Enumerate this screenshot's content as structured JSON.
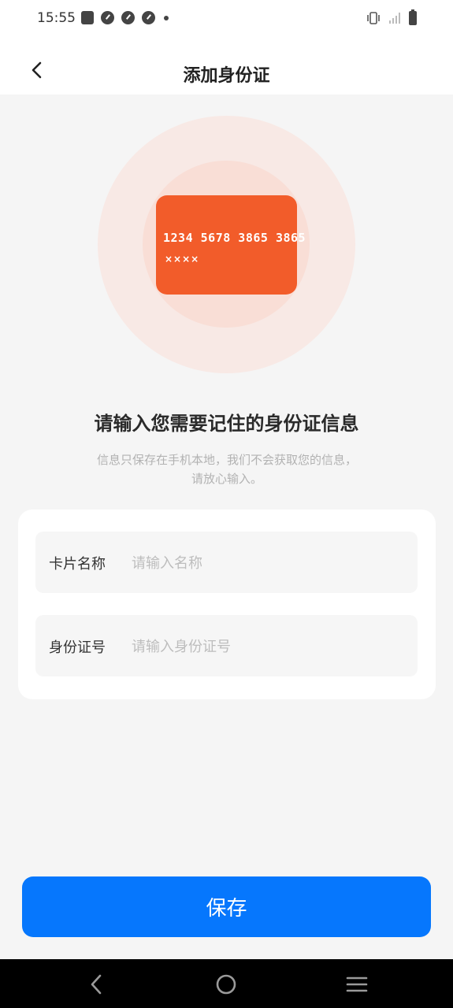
{
  "status_bar": {
    "time": "15:55",
    "icons": [
      "shopping-bag-icon",
      "gauge-icon",
      "gauge-icon",
      "gauge-icon",
      "dot-icon",
      "vibrate-icon",
      "signal-icon",
      "battery-icon"
    ]
  },
  "header": {
    "title": "添加身份证",
    "back_icon": "chevron-left-icon"
  },
  "illustration": {
    "card_number": "1234 5678 3865 3865",
    "card_mask": "××××",
    "card_color": "#f25c2a"
  },
  "intro": {
    "headline": "请输入您需要记住的身份证信息",
    "description": "信息只保存在手机本地，我们不会获取您的信息，请放心输入。"
  },
  "form": {
    "name_label": "卡片名称",
    "name_placeholder": "请输入名称",
    "name_value": "",
    "id_label": "身份证号",
    "id_placeholder": "请输入身份证号",
    "id_value": ""
  },
  "actions": {
    "save_label": "保存",
    "accent_color": "#0677fd"
  },
  "nav_bar": {
    "icons": [
      "back-icon",
      "home-icon",
      "menu-icon"
    ]
  }
}
